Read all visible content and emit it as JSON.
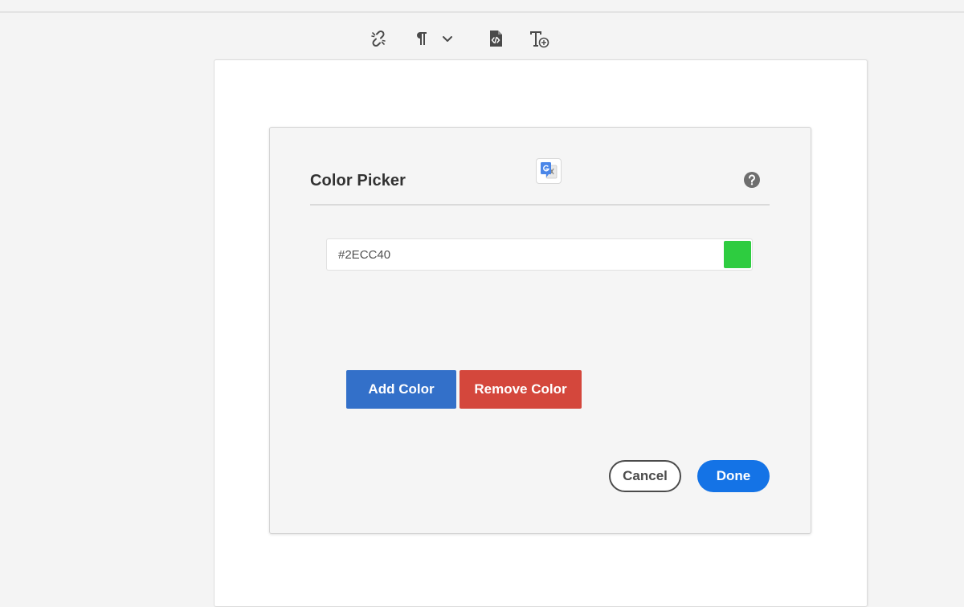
{
  "toolbar": {
    "icons": [
      "unlink-icon",
      "paragraph-icon",
      "chevron-down-icon",
      "source-file-icon",
      "text-style-icon"
    ]
  },
  "dialog": {
    "title": "Color Picker",
    "translate_icon": "google-translate-icon",
    "help_icon": "help-icon",
    "color_value": "#2ECC40",
    "swatch_color": "#2ECC40",
    "add_color_label": "Add Color",
    "remove_color_label": "Remove Color",
    "cancel_label": "Cancel",
    "done_label": "Done"
  },
  "colors": {
    "add_button": "#3370c9",
    "remove_button": "#d4473c",
    "done_button": "#1473e6"
  }
}
